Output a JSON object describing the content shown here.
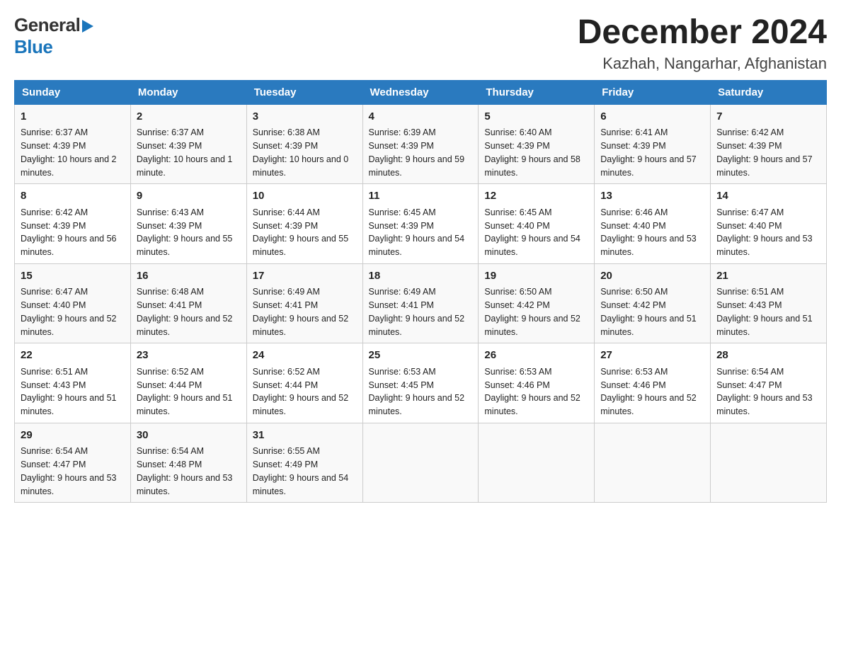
{
  "header": {
    "title": "December 2024",
    "subtitle": "Kazhah, Nangarhar, Afghanistan",
    "logo_general": "General",
    "logo_blue": "Blue"
  },
  "days_of_week": [
    "Sunday",
    "Monday",
    "Tuesday",
    "Wednesday",
    "Thursday",
    "Friday",
    "Saturday"
  ],
  "weeks": [
    [
      {
        "day": "1",
        "sunrise": "6:37 AM",
        "sunset": "4:39 PM",
        "daylight": "10 hours and 2 minutes."
      },
      {
        "day": "2",
        "sunrise": "6:37 AM",
        "sunset": "4:39 PM",
        "daylight": "10 hours and 1 minute."
      },
      {
        "day": "3",
        "sunrise": "6:38 AM",
        "sunset": "4:39 PM",
        "daylight": "10 hours and 0 minutes."
      },
      {
        "day": "4",
        "sunrise": "6:39 AM",
        "sunset": "4:39 PM",
        "daylight": "9 hours and 59 minutes."
      },
      {
        "day": "5",
        "sunrise": "6:40 AM",
        "sunset": "4:39 PM",
        "daylight": "9 hours and 58 minutes."
      },
      {
        "day": "6",
        "sunrise": "6:41 AM",
        "sunset": "4:39 PM",
        "daylight": "9 hours and 57 minutes."
      },
      {
        "day": "7",
        "sunrise": "6:42 AM",
        "sunset": "4:39 PM",
        "daylight": "9 hours and 57 minutes."
      }
    ],
    [
      {
        "day": "8",
        "sunrise": "6:42 AM",
        "sunset": "4:39 PM",
        "daylight": "9 hours and 56 minutes."
      },
      {
        "day": "9",
        "sunrise": "6:43 AM",
        "sunset": "4:39 PM",
        "daylight": "9 hours and 55 minutes."
      },
      {
        "day": "10",
        "sunrise": "6:44 AM",
        "sunset": "4:39 PM",
        "daylight": "9 hours and 55 minutes."
      },
      {
        "day": "11",
        "sunrise": "6:45 AM",
        "sunset": "4:39 PM",
        "daylight": "9 hours and 54 minutes."
      },
      {
        "day": "12",
        "sunrise": "6:45 AM",
        "sunset": "4:40 PM",
        "daylight": "9 hours and 54 minutes."
      },
      {
        "day": "13",
        "sunrise": "6:46 AM",
        "sunset": "4:40 PM",
        "daylight": "9 hours and 53 minutes."
      },
      {
        "day": "14",
        "sunrise": "6:47 AM",
        "sunset": "4:40 PM",
        "daylight": "9 hours and 53 minutes."
      }
    ],
    [
      {
        "day": "15",
        "sunrise": "6:47 AM",
        "sunset": "4:40 PM",
        "daylight": "9 hours and 52 minutes."
      },
      {
        "day": "16",
        "sunrise": "6:48 AM",
        "sunset": "4:41 PM",
        "daylight": "9 hours and 52 minutes."
      },
      {
        "day": "17",
        "sunrise": "6:49 AM",
        "sunset": "4:41 PM",
        "daylight": "9 hours and 52 minutes."
      },
      {
        "day": "18",
        "sunrise": "6:49 AM",
        "sunset": "4:41 PM",
        "daylight": "9 hours and 52 minutes."
      },
      {
        "day": "19",
        "sunrise": "6:50 AM",
        "sunset": "4:42 PM",
        "daylight": "9 hours and 52 minutes."
      },
      {
        "day": "20",
        "sunrise": "6:50 AM",
        "sunset": "4:42 PM",
        "daylight": "9 hours and 51 minutes."
      },
      {
        "day": "21",
        "sunrise": "6:51 AM",
        "sunset": "4:43 PM",
        "daylight": "9 hours and 51 minutes."
      }
    ],
    [
      {
        "day": "22",
        "sunrise": "6:51 AM",
        "sunset": "4:43 PM",
        "daylight": "9 hours and 51 minutes."
      },
      {
        "day": "23",
        "sunrise": "6:52 AM",
        "sunset": "4:44 PM",
        "daylight": "9 hours and 51 minutes."
      },
      {
        "day": "24",
        "sunrise": "6:52 AM",
        "sunset": "4:44 PM",
        "daylight": "9 hours and 52 minutes."
      },
      {
        "day": "25",
        "sunrise": "6:53 AM",
        "sunset": "4:45 PM",
        "daylight": "9 hours and 52 minutes."
      },
      {
        "day": "26",
        "sunrise": "6:53 AM",
        "sunset": "4:46 PM",
        "daylight": "9 hours and 52 minutes."
      },
      {
        "day": "27",
        "sunrise": "6:53 AM",
        "sunset": "4:46 PM",
        "daylight": "9 hours and 52 minutes."
      },
      {
        "day": "28",
        "sunrise": "6:54 AM",
        "sunset": "4:47 PM",
        "daylight": "9 hours and 53 minutes."
      }
    ],
    [
      {
        "day": "29",
        "sunrise": "6:54 AM",
        "sunset": "4:47 PM",
        "daylight": "9 hours and 53 minutes."
      },
      {
        "day": "30",
        "sunrise": "6:54 AM",
        "sunset": "4:48 PM",
        "daylight": "9 hours and 53 minutes."
      },
      {
        "day": "31",
        "sunrise": "6:55 AM",
        "sunset": "4:49 PM",
        "daylight": "9 hours and 54 minutes."
      },
      null,
      null,
      null,
      null
    ]
  ],
  "labels": {
    "sunrise": "Sunrise:",
    "sunset": "Sunset:",
    "daylight": "Daylight:"
  }
}
